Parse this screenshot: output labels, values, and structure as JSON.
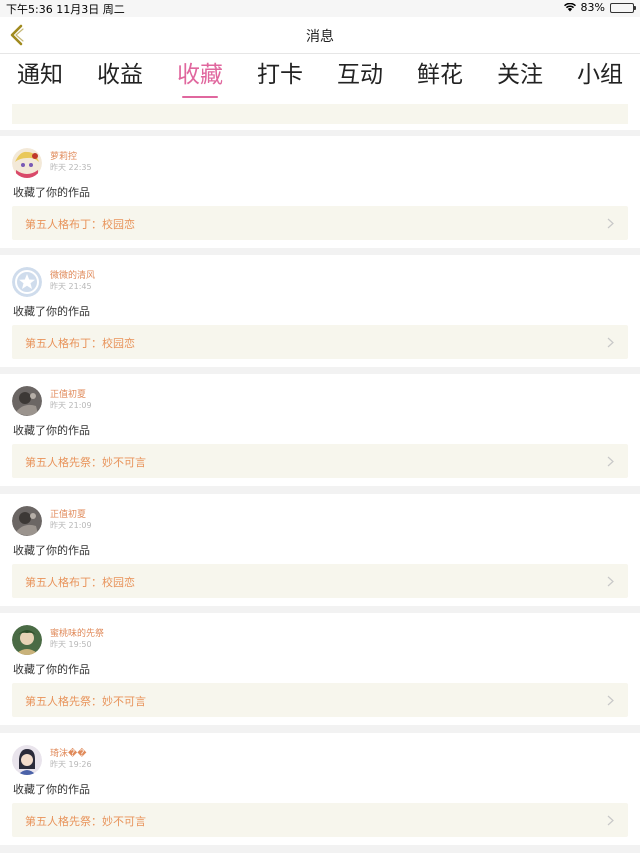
{
  "status": {
    "time_date": "下午5:36   11月3日 周二",
    "battery": "83%",
    "battery_level": 0.83
  },
  "nav": {
    "title": "消息",
    "back_icon": "chevron-left-icon"
  },
  "tabs": [
    {
      "label": "通知",
      "active": false
    },
    {
      "label": "收益",
      "active": false
    },
    {
      "label": "收藏",
      "active": true
    },
    {
      "label": "打卡",
      "active": false
    },
    {
      "label": "互动",
      "active": false
    },
    {
      "label": "鲜花",
      "active": false
    },
    {
      "label": "关注",
      "active": false
    },
    {
      "label": "小组",
      "active": false
    }
  ],
  "items": [
    {
      "user": "萝莉控",
      "time": "昨天 22:35",
      "action": "收藏了你的作品",
      "work": "第五人格布丁：校园恋"
    },
    {
      "user": "微微的清风",
      "time": "昨天 21:45",
      "action": "收藏了你的作品",
      "work": "第五人格布丁：校园恋"
    },
    {
      "user": "正值初夏",
      "time": "昨天 21:09",
      "action": "收藏了你的作品",
      "work": "第五人格先祭：妙不可言"
    },
    {
      "user": "正值初夏",
      "time": "昨天 21:09",
      "action": "收藏了你的作品",
      "work": "第五人格布丁：校园恋"
    },
    {
      "user": "蜜桃味的先祭",
      "time": "昨天 19:50",
      "action": "收藏了你的作品",
      "work": "第五人格先祭：妙不可言"
    },
    {
      "user": "琦沫��",
      "time": "昨天 19:26",
      "action": "收藏了你的作品",
      "work": "第五人格先祭：妙不可言"
    }
  ],
  "colors": {
    "accent": "#e0679e",
    "username": "#e08a5a",
    "work_title": "#e8935a",
    "work_bg": "#f7f6ed",
    "back_arrow": "#a08a1e"
  }
}
